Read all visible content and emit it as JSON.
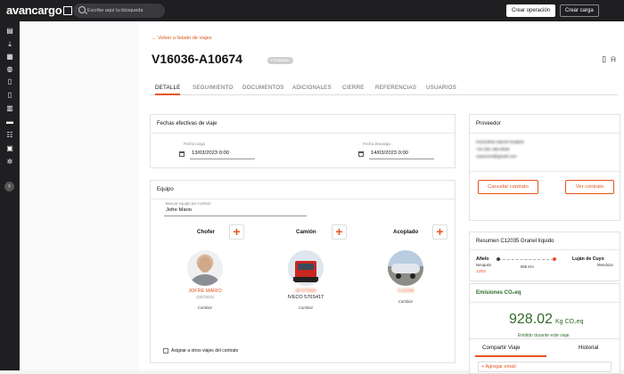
{
  "app": {
    "logo_text": "avancargo",
    "search_placeholder": "Escribe aquí tu búsqueda",
    "create_operation_label": "Crear operación",
    "create_load_label": "Crear carga"
  },
  "sidebar": {
    "icons": [
      "map-icon",
      "download-icon",
      "dashboard-icon",
      "globe-icon",
      "document-icon",
      "document-icon",
      "calendar-list-icon",
      "truck-icon",
      "team-icon",
      "building-icon",
      "settings-icon"
    ],
    "expand_icon": "chevron-right-icon"
  },
  "header": {
    "back_label": "Volver a listado de viajes",
    "trip_id": "V16036-A10674",
    "status_badge": "Finalizado"
  },
  "tabs": [
    "DETALLE",
    "SEGUIMIENTO",
    "DOCUMENTOS",
    "ADICIONALES",
    "CIERRE",
    "REFERENCIAS",
    "USUARIOS"
  ],
  "fechas": {
    "title": "Fechas efectivas de viaje",
    "carga_label": "Fecha carga",
    "carga_value": "13/03/2023 0:00",
    "descarga_label": "Fecha descarga",
    "descarga_value": "14/03/2023 0:00"
  },
  "equipo": {
    "title": "Equipo",
    "search_label": "Buscar equipo por nombre",
    "search_value": "Jofre Mario",
    "chofer_label": "Chofer",
    "camion_label": "Camión",
    "acoplado_label": "Acoplado",
    "chofer_name": "JOFRE MARIO",
    "chofer_sub": "20678032",
    "camion_plate": "AF975AA",
    "camion_model": "IVECO 570S41T",
    "acoplado_plate": "JLE008",
    "change_label": "Cambiar",
    "assign_label": "Asignar a otros viajes del contrato"
  },
  "proveedor": {
    "title": "Proveedor",
    "name": "PIZZORNI OMAR RUBEN",
    "phone": "+54 261 482-6629",
    "email": "orpizzorni@gmail.com",
    "cancel_label": "Cancelar contrato",
    "view_label": "Ver contrato"
  },
  "resumen": {
    "title": "Resumen C12035 Granel líquido",
    "origin": "Añelo",
    "origin_region": "Neuquén",
    "origin_date": "13/03",
    "distance": "865 Km",
    "destination": "Luján de Cuyo",
    "destination_region": "Mendoza"
  },
  "emisiones": {
    "title": "Emisiones CO₂eq",
    "value": "928.02",
    "unit": "Kg CO₂eq",
    "caption": "Emitido durante este viaje"
  },
  "compartir": {
    "share_tab": "Compartir Viaje",
    "history_tab": "Historial",
    "add_email": "+ Agregar email"
  },
  "colors": {
    "accent": "#e8531e",
    "green": "#2f6b2a",
    "topbar": "#1f1f22"
  }
}
